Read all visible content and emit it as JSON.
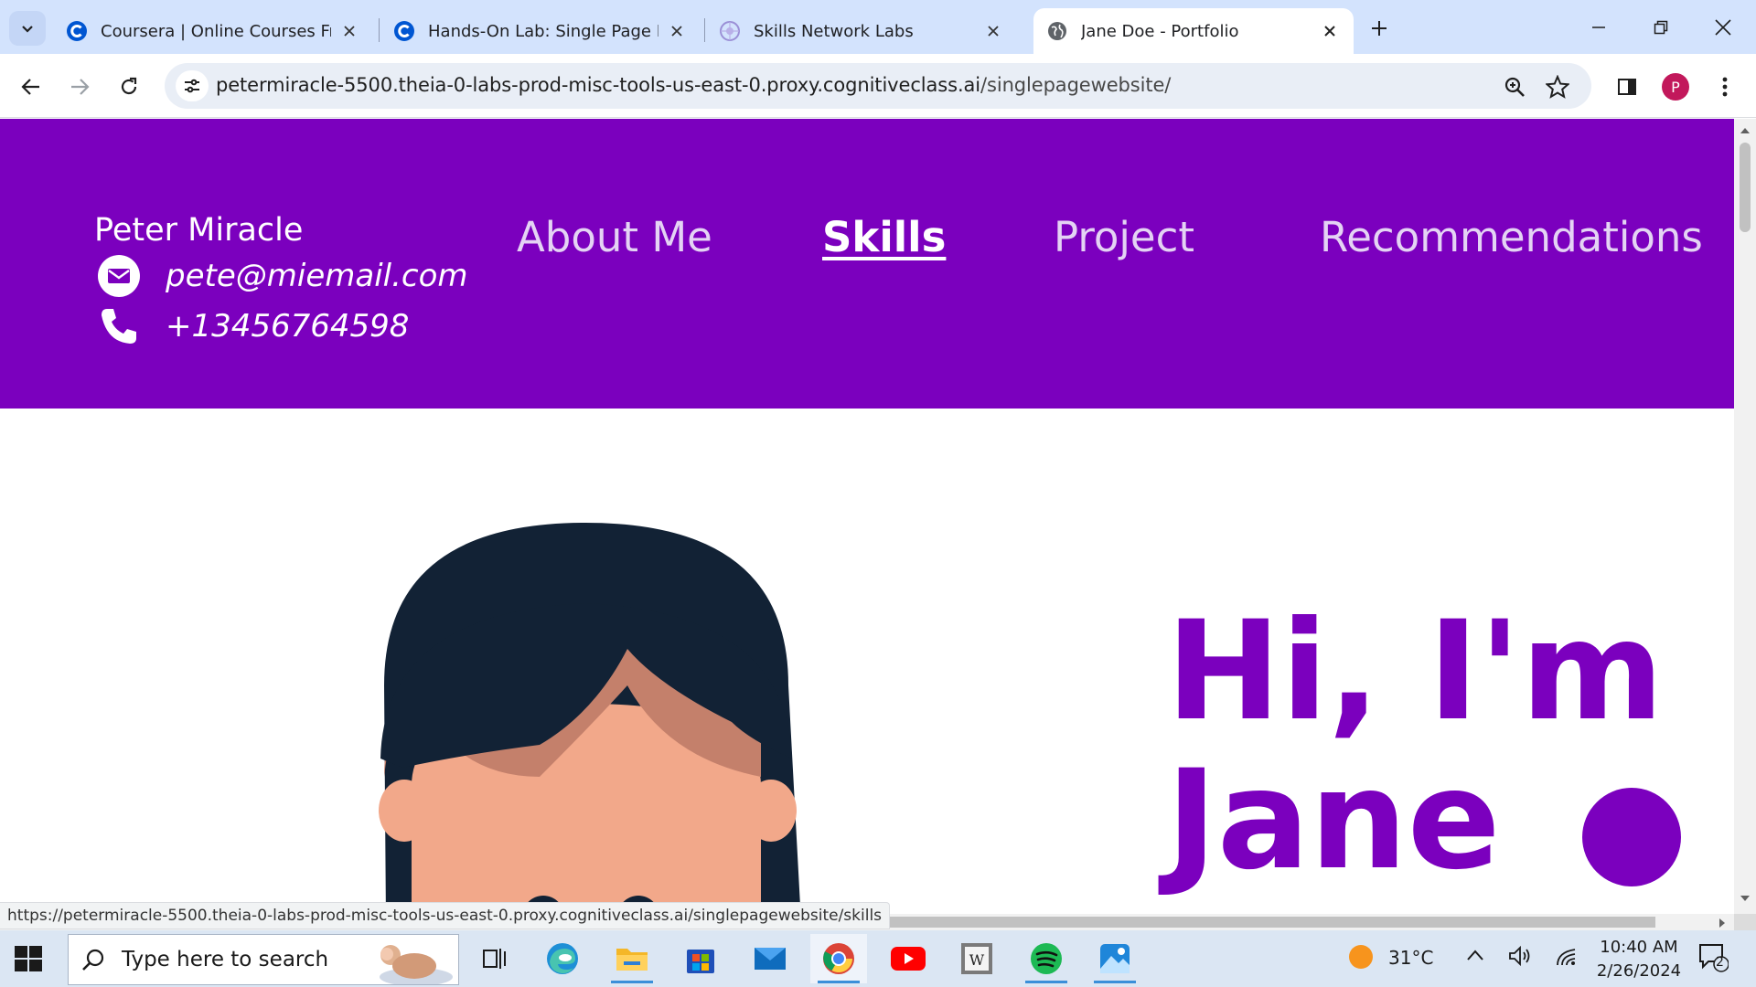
{
  "browser": {
    "tabs": [
      {
        "title": "Coursera | Online Courses From",
        "active": false,
        "favicon": "coursera-icon"
      },
      {
        "title": "Hands-On Lab: Single Page Port",
        "active": false,
        "favicon": "coursera-icon"
      },
      {
        "title": "Skills Network Labs",
        "active": false,
        "favicon": "skills-network-icon"
      },
      {
        "title": "Jane Doe - Portfolio",
        "active": true,
        "favicon": "globe-icon"
      }
    ],
    "url_host": "petermiracle-5500.theia-0-labs-prod-misc-tools-us-east-0.proxy.cognitiveclass.ai",
    "url_path": "/singlepagewebsite/",
    "profile_initial": "P",
    "status_url": "https://petermiracle-5500.theia-0-labs-prod-misc-tools-us-east-0.proxy.cognitiveclass.ai/singlepagewebsite/skills"
  },
  "page": {
    "header": {
      "name": "Peter Miracle",
      "email": "pete@miemail.com",
      "phone": "+13456764598",
      "nav": [
        {
          "label": "About Me",
          "active": false
        },
        {
          "label": "Skills",
          "active": true
        },
        {
          "label": "Project",
          "active": false
        },
        {
          "label": "Recommendations",
          "active": false
        }
      ]
    },
    "hero": {
      "line1": "Hi, I'm",
      "line2": "Jane"
    },
    "colors": {
      "brand": "#7b00be",
      "hair": "#122235",
      "skin": "#f2a88a"
    }
  },
  "taskbar": {
    "search_placeholder": "Type here to search",
    "apps": [
      "task-view-icon",
      "edge-icon",
      "file-explorer-icon",
      "microsoft-store-icon",
      "mail-icon",
      "chrome-icon",
      "youtube-icon",
      "wikipedia-icon",
      "spotify-icon",
      "photos-icon"
    ],
    "weather": "31°C",
    "time": "10:40 AM",
    "date": "2/26/2024",
    "notifications": "2"
  }
}
